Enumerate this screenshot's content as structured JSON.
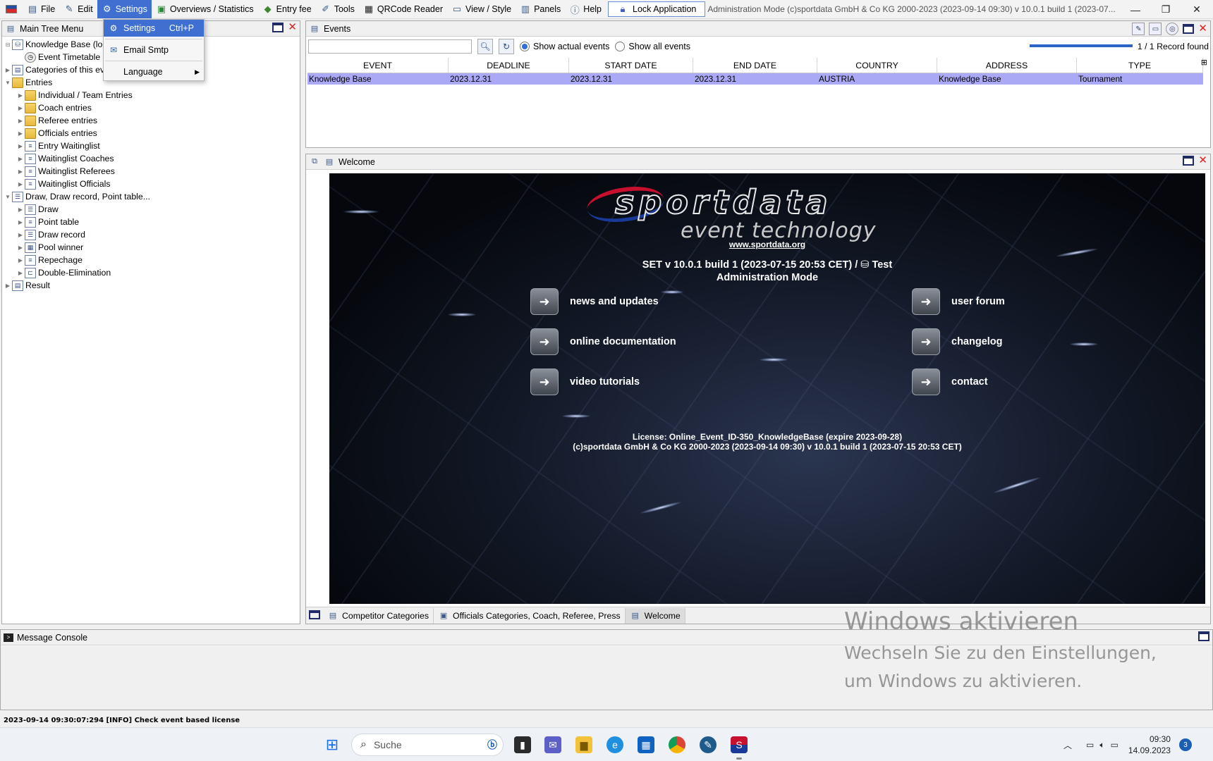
{
  "menubar": {
    "items": [
      {
        "label": "File",
        "icon": "folder-icon"
      },
      {
        "label": "Edit",
        "icon": "edit-icon"
      },
      {
        "label": "Settings",
        "icon": "gear-icon"
      },
      {
        "label": "Overviews / Statistics",
        "icon": "chart-icon"
      },
      {
        "label": "Entry fee",
        "icon": "money-icon"
      },
      {
        "label": "Tools",
        "icon": "wrench-icon"
      },
      {
        "label": "QRCode Reader",
        "icon": "qrcode-icon"
      },
      {
        "label": "View / Style",
        "icon": "window-icon"
      },
      {
        "label": "Panels",
        "icon": "panels-icon"
      },
      {
        "label": "Help",
        "icon": "help-icon"
      }
    ],
    "lock_label": "Lock Application",
    "title": "Administration Mode (c)sportdata GmbH & Co KG 2000-2023 (2023-09-14 09:30)  v 10.0.1 build 1 (2023-07..."
  },
  "settings_menu": {
    "items": [
      {
        "label": "Settings",
        "shortcut": "Ctrl+P"
      },
      {
        "label": "Email Smtp"
      },
      {
        "label": "Language"
      }
    ]
  },
  "tree": {
    "title": "Main Tree Menu",
    "rows": [
      {
        "label": "Knowledge Base (local)",
        "level": 0,
        "icon": "database-icon"
      },
      {
        "label": "Event Timetable",
        "level": 1,
        "icon": "clock-icon"
      },
      {
        "label": "Categories of this event",
        "level": 0,
        "icon": "categories-icon"
      },
      {
        "label": "Entries",
        "level": 0,
        "icon": "folder-icon"
      },
      {
        "label": "Individual / Team Entries",
        "level": 1,
        "icon": "folder-icon"
      },
      {
        "label": "Coach entries",
        "level": 1,
        "icon": "folder-icon"
      },
      {
        "label": "Referee entries",
        "level": 1,
        "icon": "folder-icon"
      },
      {
        "label": "Officials entries",
        "level": 1,
        "icon": "folder-icon"
      },
      {
        "label": "Entry Waitinglist",
        "level": 1,
        "icon": "list-icon"
      },
      {
        "label": "Waitinglist Coaches",
        "level": 1,
        "icon": "list-icon"
      },
      {
        "label": "Waitinglist Referees",
        "level": 1,
        "icon": "list-icon"
      },
      {
        "label": "Waitinglist Officials",
        "level": 1,
        "icon": "list-icon"
      },
      {
        "label": "Draw, Draw record, Point table...",
        "level": 0,
        "icon": "draw-icon"
      },
      {
        "label": "Draw",
        "level": 1,
        "icon": "draw-icon"
      },
      {
        "label": "Point table",
        "level": 1,
        "icon": "list-icon"
      },
      {
        "label": "Draw record",
        "level": 1,
        "icon": "draw-icon"
      },
      {
        "label": "Pool winner",
        "level": 1,
        "icon": "table-icon"
      },
      {
        "label": "Repechage",
        "level": 1,
        "icon": "list-icon"
      },
      {
        "label": "Double-Elimination",
        "level": 1,
        "icon": "bracket-icon"
      },
      {
        "label": "Result",
        "level": 0,
        "icon": "result-icon"
      }
    ]
  },
  "events": {
    "title": "Events",
    "search_value": "",
    "radio_actual": "Show actual events",
    "radio_all": "Show all events",
    "progress_fraction": 1.0,
    "records": "1 / 1 Record found",
    "columns": [
      "EVENT",
      "DEADLINE",
      "START DATE",
      "END DATE",
      "COUNTRY",
      "ADDRESS",
      "TYPE"
    ],
    "rows": [
      [
        "Knowledge Base",
        "2023.12.31",
        "2023.12.31",
        "2023.12.31",
        "AUSTRIA",
        "Knowledge Base",
        "Tournament"
      ]
    ]
  },
  "welcome": {
    "title": "Welcome",
    "logo_main": "sportdata",
    "logo_sub": "event technology",
    "url": "www.sportdata.org",
    "version_line1": "SET v 10.0.1 build 1 (2023-07-15 20:53 CET) /",
    "version_db": "Test",
    "version_line2": "Administration Mode",
    "links_left": [
      "news and updates",
      "online documentation",
      "video tutorials"
    ],
    "links_right": [
      "user forum",
      "changelog",
      "contact"
    ],
    "license_line1": "License: Online_Event_ID-350_KnowledgeBase (expire 2023-09-28)",
    "license_line2": "(c)sportdata GmbH & Co KG 2000-2023 (2023-09-14 09:30) v 10.0.1 build 1 (2023-07-15 20:53 CET)",
    "tabs": [
      "Competitor Categories",
      "Officials Categories, Coach, Referee, Press",
      "Welcome"
    ]
  },
  "console": {
    "title": "Message Console"
  },
  "watermark": {
    "line1": "Windows aktivieren",
    "line2": "Wechseln Sie zu den Einstellungen,",
    "line3": "um Windows zu aktivieren."
  },
  "statusline": "2023-09-14 09:30:07:294 [INFO] Check event based license",
  "taskbar": {
    "search_placeholder": "Suche",
    "time": "09:30",
    "date": "14.09.2023",
    "notification_count": "3"
  }
}
